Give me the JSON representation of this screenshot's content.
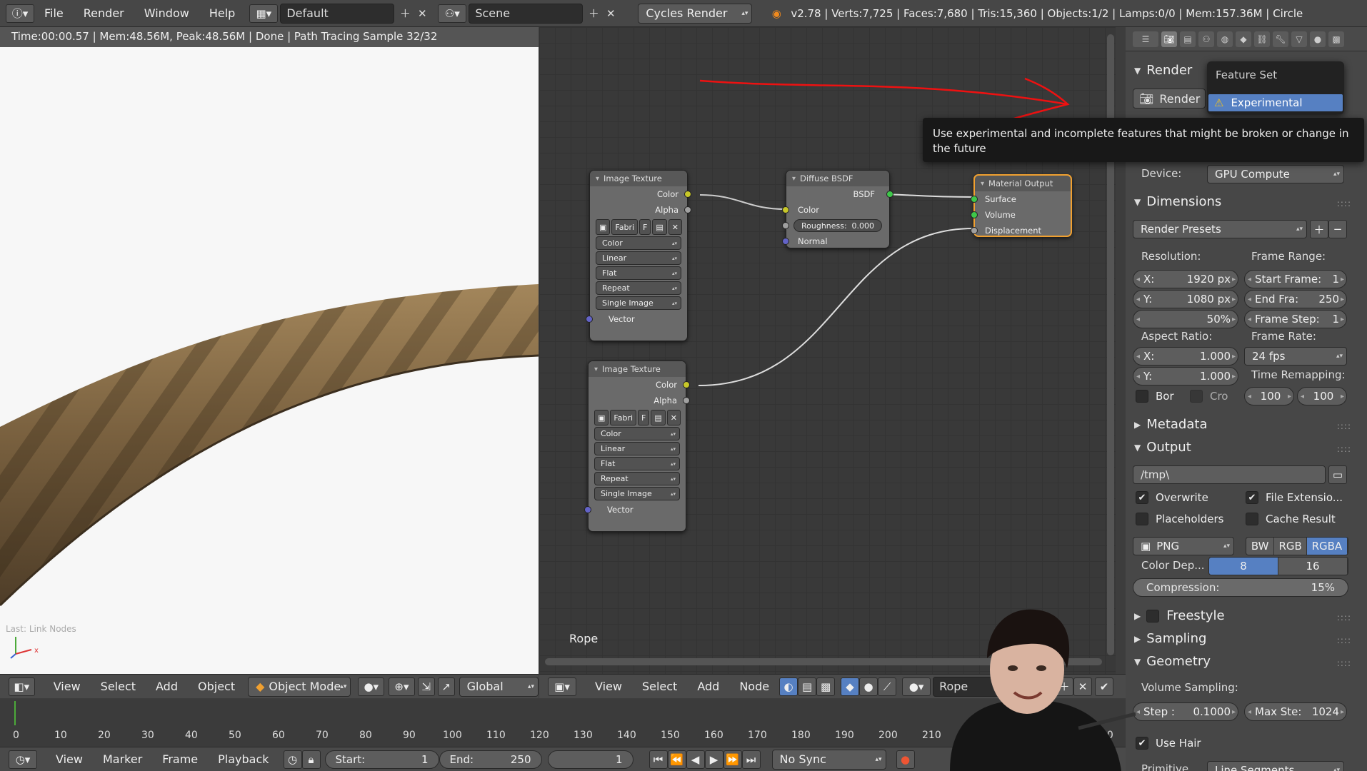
{
  "topbar": {
    "menus": [
      "File",
      "Render",
      "Window",
      "Help"
    ],
    "layout": "Default",
    "scene": "Scene",
    "engine": "Cycles Render",
    "stats": "v2.78 | Verts:7,725 | Faces:7,680 | Tris:15,360 | Objects:1/2 | Lamps:0/0 | Mem:157.36M | Circle"
  },
  "viewport": {
    "status": "Time:00:00.57 | Mem:48.56M, Peak:48.56M | Done | Path Tracing Sample 32/32",
    "last_op": "Last: Link Nodes",
    "header": {
      "menus": [
        "View",
        "Select",
        "Add",
        "Object"
      ],
      "mode": "Object Mode",
      "orientation": "Global"
    }
  },
  "nodes": {
    "object_label": "Rope",
    "image_texture_1": {
      "title": "Image Texture",
      "out_color": "Color",
      "out_alpha": "Alpha",
      "image_name": "Fabri",
      "image_f": "F",
      "opt_color": "Color",
      "opt_interp": "Linear",
      "opt_proj": "Flat",
      "opt_ext": "Repeat",
      "opt_src": "Single Image",
      "in_vector": "Vector"
    },
    "image_texture_2": {
      "title": "Image Texture",
      "out_color": "Color",
      "out_alpha": "Alpha",
      "image_name": "Fabri",
      "image_f": "F",
      "opt_color": "Color",
      "opt_interp": "Linear",
      "opt_proj": "Flat",
      "opt_ext": "Repeat",
      "opt_src": "Single Image",
      "in_vector": "Vector"
    },
    "diffuse": {
      "title": "Diffuse BSDF",
      "out_bsdf": "BSDF",
      "in_color": "Color",
      "roughness_label": "Roughness:",
      "roughness_value": "0.000",
      "in_normal": "Normal"
    },
    "output": {
      "title": "Material Output",
      "surface": "Surface",
      "volume": "Volume",
      "displacement": "Displacement"
    },
    "header": {
      "menus": [
        "View",
        "Select",
        "Add",
        "Node"
      ],
      "material": "Rope",
      "fake": "F"
    }
  },
  "props": {
    "render_header": "Render",
    "render_btn": "Render",
    "popup_title": "Feature Set",
    "popup_item": "Experimental",
    "tooltip": "Use experimental and incomplete features that might be broken or change in the future",
    "device_label": "Device:",
    "device_value": "GPU Compute",
    "dimensions": "Dimensions",
    "presets": "Render Presets",
    "resolution_label": "Resolution:",
    "res_x_label": "X:",
    "res_x": "1920 px",
    "res_y_label": "Y:",
    "res_y": "1080 px",
    "res_pct": "50%",
    "frame_range_label": "Frame Range:",
    "start_frame_label": "Start Frame:",
    "start_frame": "1",
    "end_frame_label": "End Fra:",
    "end_frame": "250",
    "frame_step_label": "Frame Step:",
    "frame_step": "1",
    "aspect_label": "Aspect Ratio:",
    "aspect_x_label": "X:",
    "aspect_x": "1.000",
    "aspect_y_label": "Y:",
    "aspect_y": "1.000",
    "frame_rate_label": "Frame Rate:",
    "frame_rate": "24 fps",
    "time_remap_label": "Time Remapping:",
    "remap_old": "100",
    "remap_new": "100",
    "border": "Bor",
    "crop": "Cro",
    "metadata": "Metadata",
    "output": "Output",
    "path": "/tmp\\",
    "overwrite": "Overwrite",
    "file_ext": "File Extensio...",
    "placeholders": "Placeholders",
    "cache_result": "Cache Result",
    "format": "PNG",
    "bw": "BW",
    "rgb": "RGB",
    "rgba": "RGBA",
    "color_depth_label": "Color Dep...",
    "depth_8": "8",
    "depth_16": "16",
    "compression_label": "Compression:",
    "compression": "15%",
    "freestyle": "Freestyle",
    "sampling": "Sampling",
    "geometry": "Geometry",
    "volume_sampling": "Volume Sampling:",
    "step_label": "Step :",
    "step": "0.1000",
    "max_steps_label": "Max Ste:",
    "max_steps": "1024",
    "use_hair": "Use Hair",
    "primitive_label": "Primitive",
    "primitive": "Line Segments"
  },
  "timeline": {
    "ticks": [
      "0",
      "10",
      "20",
      "30",
      "40",
      "50",
      "60",
      "70",
      "80",
      "90",
      "100",
      "110",
      "120",
      "130",
      "140",
      "150",
      "160",
      "170",
      "180",
      "190",
      "200",
      "210",
      "250"
    ],
    "menus": [
      "View",
      "Marker",
      "Frame",
      "Playback"
    ],
    "start_label": "Start:",
    "start": "1",
    "end_label": "End:",
    "end": "250",
    "current": "1",
    "sync": "No Sync"
  }
}
